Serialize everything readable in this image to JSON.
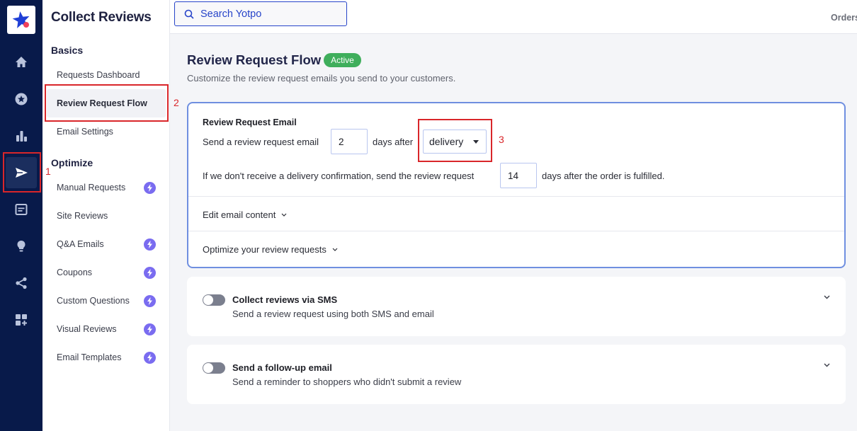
{
  "rail": {
    "items": [
      {
        "icon": "home-icon",
        "active": false
      },
      {
        "icon": "star-badge-icon",
        "active": false
      },
      {
        "icon": "bar-chart-icon",
        "active": false
      },
      {
        "icon": "send-icon",
        "active": true
      },
      {
        "icon": "page-icon",
        "active": false
      },
      {
        "icon": "lightbulb-icon",
        "active": false
      },
      {
        "icon": "share-icon",
        "active": false
      },
      {
        "icon": "add-apps-icon",
        "active": false
      }
    ]
  },
  "sidebar": {
    "title": "Collect Reviews",
    "sections": [
      {
        "title": "Basics",
        "items": [
          {
            "label": "Requests Dashboard",
            "pro": false,
            "active": false
          },
          {
            "label": "Review Request Flow",
            "pro": false,
            "active": true
          },
          {
            "label": "Email Settings",
            "pro": false,
            "active": false
          }
        ]
      },
      {
        "title": "Optimize",
        "items": [
          {
            "label": "Manual Requests",
            "pro": true
          },
          {
            "label": "Site Reviews",
            "pro": false
          },
          {
            "label": "Q&A Emails",
            "pro": true
          },
          {
            "label": "Coupons",
            "pro": true
          },
          {
            "label": "Custom Questions",
            "pro": true
          },
          {
            "label": "Visual Reviews",
            "pro": true
          },
          {
            "label": "Email Templates",
            "pro": true
          }
        ]
      }
    ]
  },
  "topbar": {
    "search_placeholder": "Search Yotpo",
    "orders_label": "Orders"
  },
  "page": {
    "title": "Review Request Flow",
    "status_badge": "Active",
    "subtitle": "Customize the review request emails you send to your customers."
  },
  "email_card": {
    "heading": "Review Request Email",
    "row1_prefix": "Send a review request email",
    "days_value": "2",
    "row1_middle": "days after",
    "trigger_selected": "delivery",
    "row2_prefix": "If we don't receive a delivery confirmation, send the review request",
    "fallback_days_value": "14",
    "row2_suffix": "days after the order is fulfilled.",
    "edit_content_label": "Edit email content",
    "optimize_label": "Optimize your review requests"
  },
  "toggles": [
    {
      "title": "Collect reviews via SMS",
      "description": "Send a review request using both SMS and email",
      "enabled": false
    },
    {
      "title": "Send a follow-up email",
      "description": "Send a reminder to shoppers who didn't submit a review",
      "enabled": false
    }
  ],
  "annotations": [
    "1",
    "2",
    "3"
  ],
  "colors": {
    "rail_bg": "#081a4a",
    "accent_blue": "#2744c9",
    "active_badge": "#3fae5c",
    "pro_bolt": "#7a6cf0",
    "annotation_red": "#d9262a"
  }
}
